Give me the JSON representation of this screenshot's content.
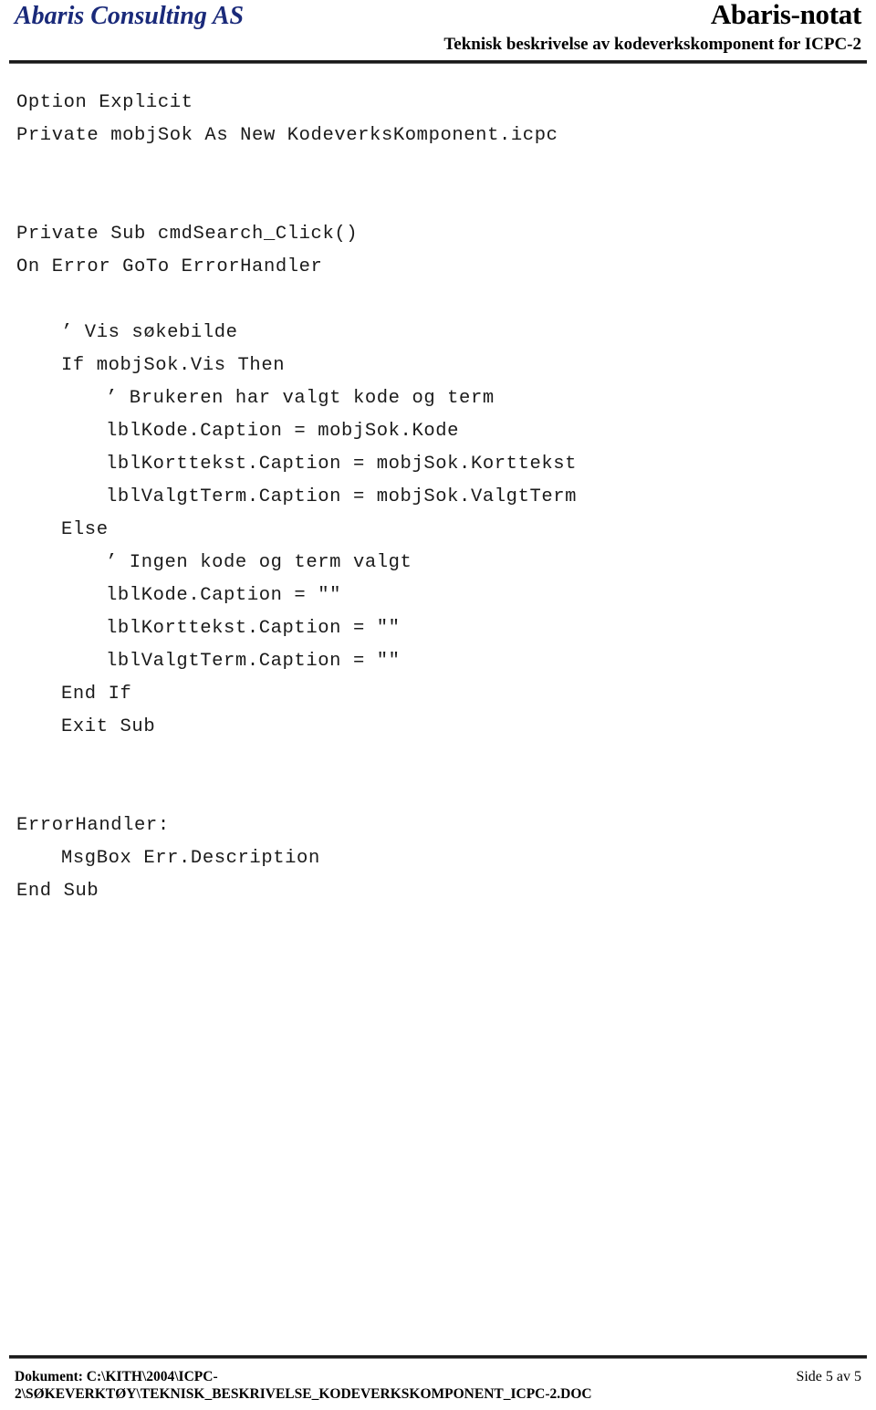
{
  "header": {
    "company": "Abaris Consulting AS",
    "doc_type": "Abaris-notat",
    "subtitle": "Teknisk beskrivelse av kodeverkskomponent for ICPC-2",
    "company_color": "#1a2a7a"
  },
  "code": {
    "lines": [
      {
        "text": "Option Explicit",
        "indent": 0
      },
      {
        "text": "Private mobjSok As New KodeverksKomponent.icpc",
        "indent": 0
      },
      {
        "text": "",
        "indent": 0
      },
      {
        "text": "",
        "indent": 0
      },
      {
        "text": "Private Sub cmdSearch_Click()",
        "indent": 0
      },
      {
        "text": "On Error GoTo ErrorHandler",
        "indent": 0
      },
      {
        "text": "",
        "indent": 0
      },
      {
        "text": "’ Vis søkebilde",
        "indent": 1
      },
      {
        "text": "If mobjSok.Vis Then",
        "indent": 1
      },
      {
        "text": "’ Brukeren har valgt kode og term",
        "indent": 2
      },
      {
        "text": "lblKode.Caption = mobjSok.Kode",
        "indent": 2
      },
      {
        "text": "lblKorttekst.Caption = mobjSok.Korttekst",
        "indent": 2
      },
      {
        "text": "lblValgtTerm.Caption = mobjSok.ValgtTerm",
        "indent": 2
      },
      {
        "text": "Else",
        "indent": 1
      },
      {
        "text": "’ Ingen kode og term valgt",
        "indent": 2
      },
      {
        "text": "lblKode.Caption = \"\"",
        "indent": 2
      },
      {
        "text": "lblKorttekst.Caption = \"\"",
        "indent": 2
      },
      {
        "text": "lblValgtTerm.Caption = \"\"",
        "indent": 2
      },
      {
        "text": "End If",
        "indent": 1
      },
      {
        "text": "Exit Sub",
        "indent": 1
      },
      {
        "text": "",
        "indent": 0
      },
      {
        "text": "",
        "indent": 0
      },
      {
        "text": "ErrorHandler:",
        "indent": 0
      },
      {
        "text": "MsgBox Err.Description",
        "indent": 1
      },
      {
        "text": "End Sub",
        "indent": 0
      }
    ]
  },
  "footer": {
    "doc_label_line1": "Dokument: C:\\KITH\\2004\\ICPC-",
    "doc_label_line2": "2\\SØKEVERKTØY\\TEKNISK_BESKRIVELSE_KODEVERKSKOMPONENT_ICPC-2.DOC",
    "page_label": "Side 5 av 5"
  }
}
